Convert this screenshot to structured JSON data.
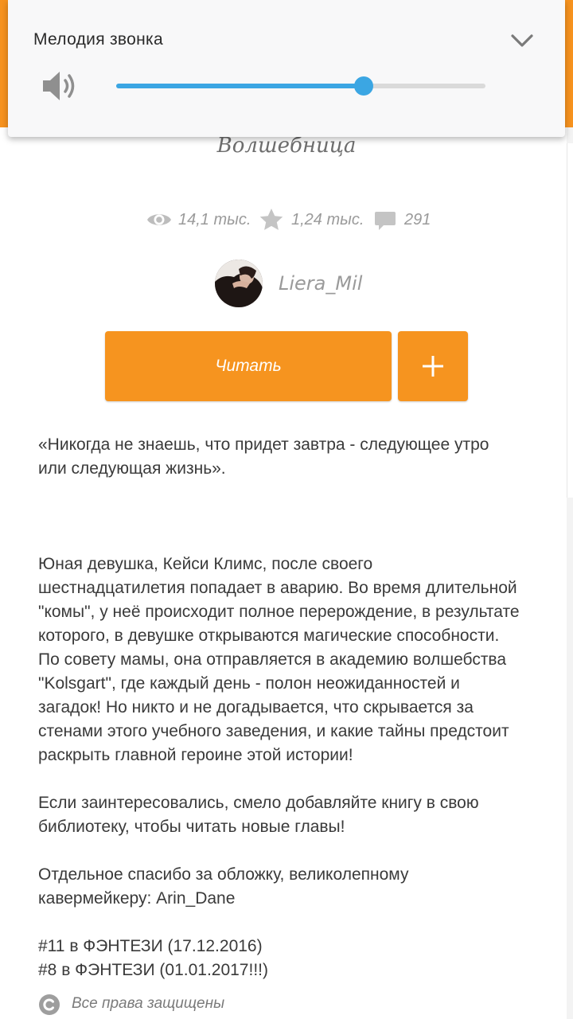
{
  "volume": {
    "title": "Мелодия звонка",
    "level": 0.67
  },
  "book": {
    "title": "Волшебница",
    "views": "14,1 тыс.",
    "votes": "1,24 тыс.",
    "comments": "291",
    "author": "Liera_Mil"
  },
  "actions": {
    "read_label": "Читать"
  },
  "description": {
    "p1_l1": "«Никогда не знаешь, что придет завтра - следующее утро",
    "p1_l2": "или следующая жизнь».",
    "p2_l1": "Юная девушка, Кейси Климс, после своего",
    "p2_l2": "шестнадцатилетия попадает в аварию. Во время длительной",
    "p2_l3": "\"комы\", у неё происходит полное перерождение, в результате",
    "p2_l4": "которого, в девушке открываются магические способности.",
    "p2_l5": "По совету мамы, она отправляется в академию волшебства",
    "p2_l6": "\"Kolsgart\", где каждый день - полон неожиданностей и",
    "p2_l7": "загадок! Но никто и не догадывается, что скрывается за",
    "p2_l8": "стенами этого учебного заведения, и какие тайны предстоит",
    "p2_l9": "раскрыть главной героине этой истории!",
    "p3_l1": "Если заинтересовались, смело добавляйте книгу в свою",
    "p3_l2": "библиотеку, чтобы читать новые главы!",
    "p4_l1": "Отдельное спасибо за обложку, великолепному",
    "p4_l2": "кавермейкеру: Arin_Dane",
    "p5_l1": "#11 в ФЭНТЕЗИ (17.12.2016)",
    "p5_l2": "#8 в ФЭНТЕЗИ   (01.01.2017!!!)"
  },
  "footer": {
    "copyright": "Все права защищены"
  },
  "colors": {
    "accent_orange": "#f6941f",
    "slider_blue": "#3ba6e3"
  },
  "icons": [
    "chevron-down-icon",
    "speaker-icon",
    "eye-icon",
    "star-icon",
    "comment-icon",
    "plus-icon",
    "copyright-icon"
  ]
}
